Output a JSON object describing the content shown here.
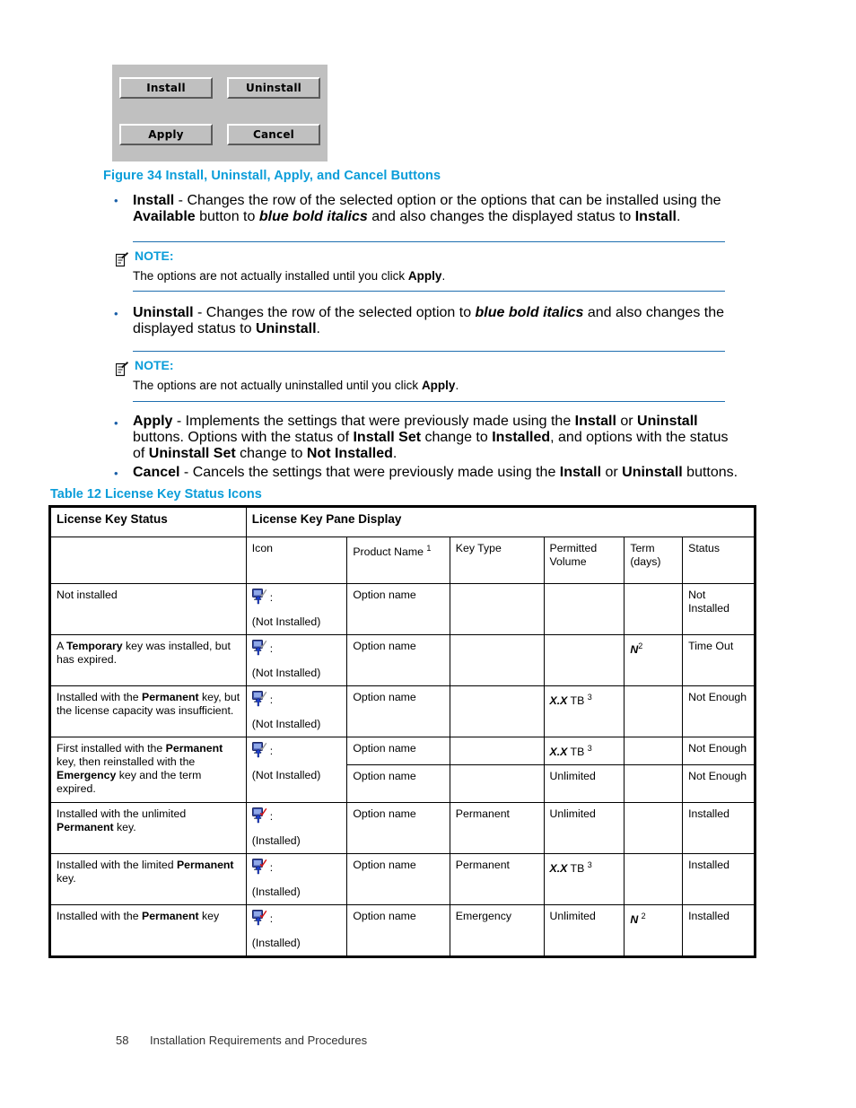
{
  "figure": {
    "buttons": [
      {
        "name": "install",
        "label": "Install"
      },
      {
        "name": "uninstall",
        "label": "Uninstall"
      },
      {
        "name": "apply",
        "label": "Apply"
      },
      {
        "name": "cancel",
        "label": "Cancel"
      }
    ],
    "caption": "Figure 34 Install, Uninstall, Apply, and Cancel Buttons"
  },
  "bullets": {
    "install": {
      "term": "Install",
      "sep": " - ",
      "p1": "Changes the row of the selected option or the options that can be installed using the ",
      "available": "Available",
      "p2": " button to ",
      "emph": "blue bold italics",
      "p3": " and also changes the displayed status to ",
      "end_term": "Install",
      "period": "."
    },
    "uninstall": {
      "term": "Uninstall",
      "sep": " - ",
      "p1": "Changes the row of the selected option to ",
      "emph": "blue bold italics",
      "p2": " and also changes the displayed status to ",
      "end_term": "Uninstall",
      "period": "."
    },
    "apply": {
      "term": "Apply",
      "sep": " - ",
      "p1": "Implements the settings that were previously made using the ",
      "t1": "Install",
      "p2": " or ",
      "t2": "Uninstall",
      "p3": " buttons. Options with the status of ",
      "t3": "Install Set",
      "p4": " change to ",
      "t4": "Installed",
      "p5": ", and options with the status of ",
      "t5": "Uninstall Set",
      "p6": " change to ",
      "t6": "Not Installed",
      "period": "."
    },
    "cancel": {
      "term": "Cancel",
      "sep": " - ",
      "p1": "Cancels the settings that were previously made using the ",
      "t1": "Install",
      "p2": " or ",
      "t2": "Uninstall",
      "p3": " buttons."
    }
  },
  "notes": [
    {
      "label": "NOTE:",
      "p1": "The options are not actually installed until you click ",
      "bold": "Apply",
      "p2": "."
    },
    {
      "label": "NOTE:",
      "p1": "The options are not actually uninstalled until you click ",
      "bold": "Apply",
      "p2": "."
    }
  ],
  "table": {
    "caption": "Table 12 License Key Status Icons",
    "header_main": {
      "left": "License Key Status",
      "right": "License Key Pane Display"
    },
    "header_cols": {
      "icon": "Icon",
      "product_name": "Product Name",
      "product_name_sup": "1",
      "key_type": "Key Type",
      "permitted_volume": "Permitted Volume",
      "term": "Term (days)",
      "status": "Status"
    },
    "rows": [
      {
        "status_plain": "Not installed",
        "icon_kind": "not-installed",
        "icon_caption": "(Not Installed)",
        "product_name": "Option name",
        "key_type": "",
        "permitted_volume": "",
        "permitted_bi": "",
        "permitted_sup": "",
        "term": "",
        "term_sup": "",
        "status": "Not Installed"
      },
      {
        "status_pre": "A ",
        "status_bold": "Temporary",
        "status_post": " key was installed, but has expired.",
        "icon_kind": "not-installed",
        "icon_caption": "(Not Installed)",
        "product_name": "Option name",
        "key_type": "",
        "permitted_volume": "",
        "permitted_bi": "",
        "permitted_sup": "",
        "term_bi": "N",
        "term_sup": "2",
        "status": "Time Out"
      },
      {
        "status_pre": "Installed with the ",
        "status_bold": "Permanent",
        "status_post": " key, but the license capacity was insufficient.",
        "icon_kind": "not-installed",
        "icon_caption": "(Not Installed)",
        "product_name": "Option name",
        "key_type": "",
        "permitted_bi": "X.X",
        "permitted_volume": " TB ",
        "permitted_sup": "3",
        "term": "",
        "term_sup": "",
        "status": "Not Enough"
      },
      {
        "status_pre": "First installed with the ",
        "status_bold": "Permanent",
        "status_mid": " key, then reinstalled with the ",
        "status_bold2": "Emergency",
        "status_post": " key and the term expired.",
        "icon_kind": "not-installed",
        "icon_caption": "(Not Installed)",
        "sub_rows": [
          {
            "product_name": "Option name",
            "key_type": "",
            "permitted_bi": "X.X",
            "permitted_volume": " TB ",
            "permitted_sup": "3",
            "term": "",
            "status": "Not Enough"
          },
          {
            "product_name": "Option name",
            "key_type": "",
            "permitted_bi": "",
            "permitted_volume": "Unlimited",
            "permitted_sup": "",
            "term": "",
            "status": "Not Enough"
          }
        ]
      },
      {
        "status_pre": "Installed with the unlimited ",
        "status_bold": "Permanent",
        "status_post": " key.",
        "icon_kind": "installed",
        "icon_caption": "(Installed)",
        "product_name": "Option name",
        "key_type": "Permanent",
        "permitted_bi": "",
        "permitted_volume": "Unlimited",
        "permitted_sup": "",
        "term": "",
        "term_sup": "",
        "status": "Installed"
      },
      {
        "status_pre": "Installed with the limited ",
        "status_bold": "Permanent",
        "status_post": " key.",
        "icon_kind": "installed",
        "icon_caption": "(Installed)",
        "product_name": "Option name",
        "key_type": "Permanent",
        "permitted_bi": "X.X",
        "permitted_volume": " TB ",
        "permitted_sup": "3",
        "term": "",
        "term_sup": "",
        "status": "Installed"
      },
      {
        "status_pre": "Installed with the ",
        "status_bold": "Permanent",
        "status_post": " key",
        "icon_kind": "installed",
        "icon_caption": "(Installed)",
        "product_name": "Option name",
        "key_type": "Emergency",
        "permitted_bi": "",
        "permitted_volume": "Unlimited",
        "permitted_sup": "",
        "term_bi": "N",
        "term_sup": "2",
        "status": "Installed"
      }
    ]
  },
  "footer": {
    "page_number": "58",
    "chapter": "Installation Requirements and Procedures"
  },
  "colors": {
    "heading_blue": "#0b9dd9",
    "rule_blue": "#1f6fb0",
    "panel_gray": "#c0c0c0"
  }
}
